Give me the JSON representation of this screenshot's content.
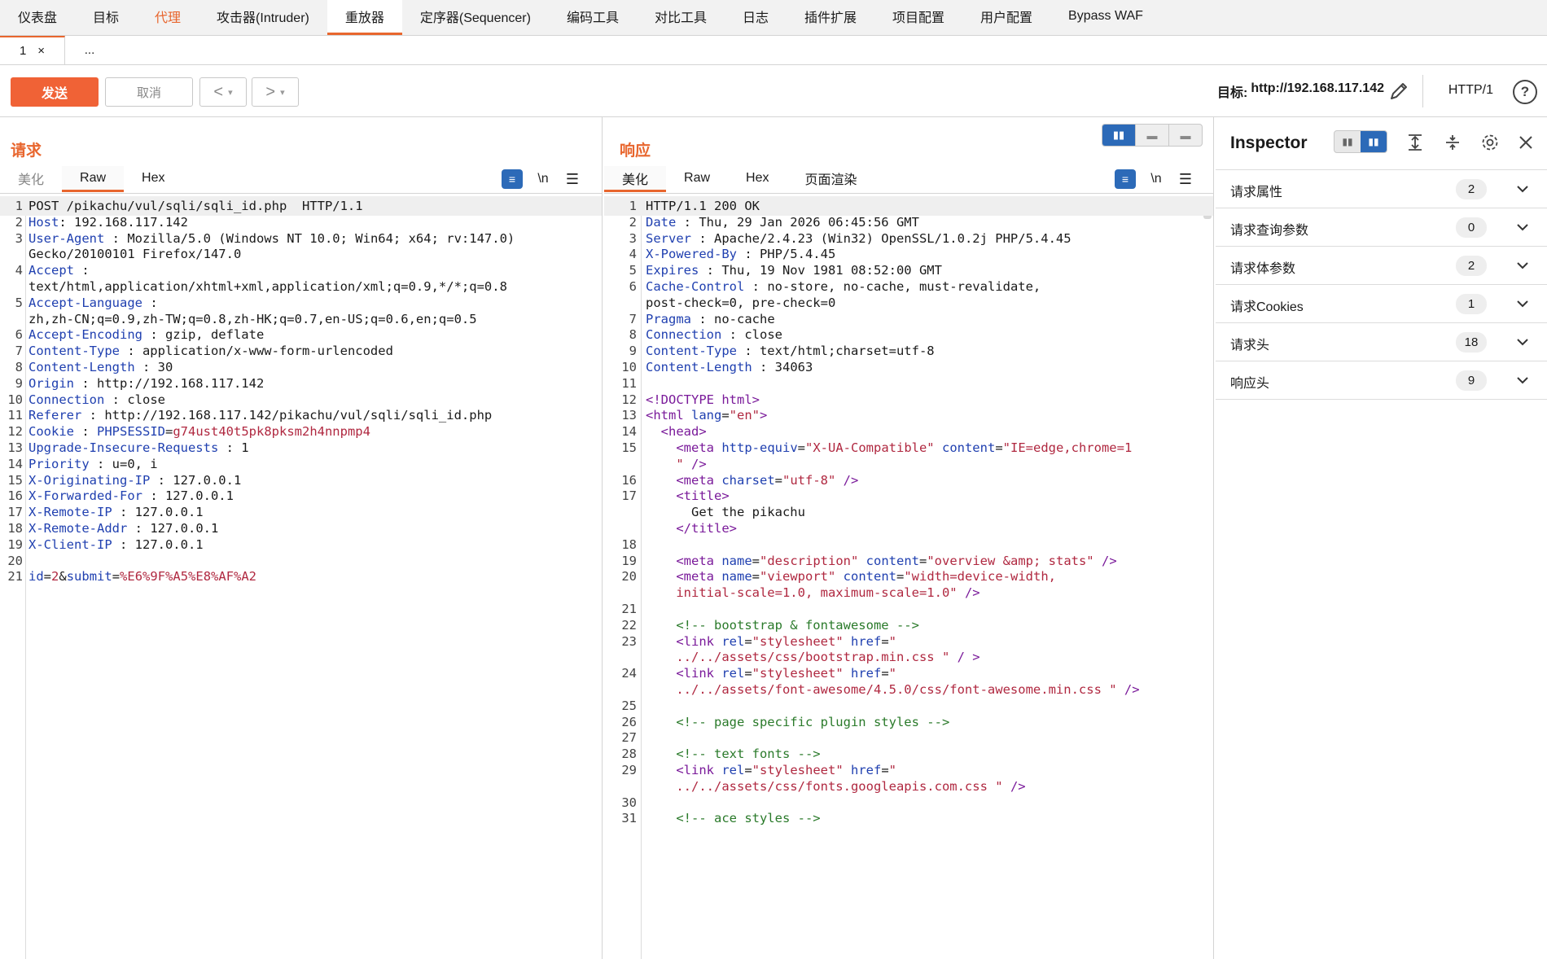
{
  "top_tabs": [
    "仪表盘",
    "目标",
    "代理",
    "攻击器(Intruder)",
    "重放器",
    "定序器(Sequencer)",
    "编码工具",
    "对比工具",
    "日志",
    "插件扩展",
    "项目配置",
    "用户配置",
    "Bypass WAF"
  ],
  "sub_tabs": {
    "first_label": "1",
    "close": "×",
    "more": "..."
  },
  "toolbar": {
    "send": "发送",
    "cancel": "取消",
    "prev": "<",
    "next": ">",
    "dropdown": "▾",
    "target_label": "目标:",
    "target_url": "http://192.168.117.142",
    "http_version": "HTTP/1",
    "help": "?"
  },
  "request": {
    "title": "请求",
    "tabs": [
      "美化",
      "Raw",
      "Hex"
    ],
    "wrap_icon": "≡",
    "newline": "\\n",
    "menu": "☰",
    "lines": [
      {
        "n": "1",
        "parts": [
          [
            "v",
            "POST /pikachu/vul/sqli/sqli_id.php  HTTP/1.1"
          ]
        ]
      },
      {
        "n": "2",
        "parts": [
          [
            "k",
            "Host"
          ],
          [
            "v",
            ": 192.168.117.142"
          ]
        ]
      },
      {
        "n": "3",
        "parts": [
          [
            "k",
            "User-Agent"
          ],
          [
            "v",
            " : Mozilla/5.0 (Windows NT 10.0; Win64; x64; rv:147.0)"
          ]
        ]
      },
      {
        "n": "",
        "parts": [
          [
            "v",
            "Gecko/20100101 Firefox/147.0"
          ]
        ]
      },
      {
        "n": "4",
        "parts": [
          [
            "k",
            "Accept"
          ],
          [
            "v",
            " :"
          ]
        ]
      },
      {
        "n": "",
        "parts": [
          [
            "v",
            "text/html,application/xhtml+xml,application/xml;q=0.9,*/*;q=0.8"
          ]
        ]
      },
      {
        "n": "5",
        "parts": [
          [
            "k",
            "Accept-Language"
          ],
          [
            "v",
            " :"
          ]
        ]
      },
      {
        "n": "",
        "parts": [
          [
            "v",
            "zh,zh-CN;q=0.9,zh-TW;q=0.8,zh-HK;q=0.7,en-US;q=0.6,en;q=0.5"
          ]
        ]
      },
      {
        "n": "6",
        "parts": [
          [
            "k",
            "Accept-Encoding"
          ],
          [
            "v",
            " : gzip, deflate"
          ]
        ]
      },
      {
        "n": "7",
        "parts": [
          [
            "k",
            "Content-Type"
          ],
          [
            "v",
            " : application/x-www-form-urlencoded"
          ]
        ]
      },
      {
        "n": "8",
        "parts": [
          [
            "k",
            "Content-Length"
          ],
          [
            "v",
            " : 30"
          ]
        ]
      },
      {
        "n": "9",
        "parts": [
          [
            "k",
            "Origin"
          ],
          [
            "v",
            " : http://192.168.117.142"
          ]
        ]
      },
      {
        "n": "10",
        "parts": [
          [
            "k",
            "Connection"
          ],
          [
            "v",
            " : close"
          ]
        ]
      },
      {
        "n": "11",
        "parts": [
          [
            "k",
            "Referer"
          ],
          [
            "v",
            " : http://192.168.117.142/pikachu/vul/sqli/sqli_id.php"
          ]
        ]
      },
      {
        "n": "12",
        "parts": [
          [
            "k",
            "Cookie"
          ],
          [
            "v",
            " : "
          ],
          [
            "k",
            "PHPSESSID"
          ],
          [
            "v",
            "="
          ],
          [
            "r",
            "g74ust40t5pk8pksm2h4nnpmp4"
          ]
        ]
      },
      {
        "n": "13",
        "parts": [
          [
            "k",
            "Upgrade-Insecure-Requests"
          ],
          [
            "v",
            " : 1"
          ]
        ]
      },
      {
        "n": "14",
        "parts": [
          [
            "k",
            "Priority"
          ],
          [
            "v",
            " : u=0, i"
          ]
        ]
      },
      {
        "n": "15",
        "parts": [
          [
            "k",
            "X-Originating-IP"
          ],
          [
            "v",
            " : 127.0.0.1"
          ]
        ]
      },
      {
        "n": "16",
        "parts": [
          [
            "k",
            "X-Forwarded-For"
          ],
          [
            "v",
            " : 127.0.0.1"
          ]
        ]
      },
      {
        "n": "17",
        "parts": [
          [
            "k",
            "X-Remote-IP"
          ],
          [
            "v",
            " : 127.0.0.1"
          ]
        ]
      },
      {
        "n": "18",
        "parts": [
          [
            "k",
            "X-Remote-Addr"
          ],
          [
            "v",
            " : 127.0.0.1"
          ]
        ]
      },
      {
        "n": "19",
        "parts": [
          [
            "k",
            "X-Client-IP"
          ],
          [
            "v",
            " : 127.0.0.1"
          ]
        ]
      },
      {
        "n": "20",
        "parts": []
      },
      {
        "n": "21",
        "parts": [
          [
            "k",
            "id"
          ],
          [
            "v",
            "="
          ],
          [
            "r",
            "2"
          ],
          [
            "v",
            "&"
          ],
          [
            "k",
            "submit"
          ],
          [
            "v",
            "="
          ],
          [
            "r",
            "%E6%9F%A5%E8%AF%A2"
          ]
        ]
      }
    ]
  },
  "response": {
    "title": "响应",
    "tabs": [
      "美化",
      "Raw",
      "Hex",
      "页面渲染"
    ],
    "wrap_icon": "≡",
    "newline": "\\n",
    "menu": "☰",
    "layout_icons": [
      "▮▮",
      "▬",
      "▬"
    ],
    "lines": [
      {
        "n": "1",
        "parts": [
          [
            "v",
            "HTTP/1.1 200 OK"
          ]
        ]
      },
      {
        "n": "2",
        "parts": [
          [
            "k",
            "Date"
          ],
          [
            "v",
            " : Thu, 29 Jan 2026 06:45:56 GMT"
          ]
        ]
      },
      {
        "n": "3",
        "parts": [
          [
            "k",
            "Server"
          ],
          [
            "v",
            " : Apache/2.4.23 (Win32) OpenSSL/1.0.2j PHP/5.4.45"
          ]
        ]
      },
      {
        "n": "4",
        "parts": [
          [
            "k",
            "X-Powered-By"
          ],
          [
            "v",
            " : PHP/5.4.45"
          ]
        ]
      },
      {
        "n": "5",
        "parts": [
          [
            "k",
            "Expires"
          ],
          [
            "v",
            " : Thu, 19 Nov 1981 08:52:00 GMT"
          ]
        ]
      },
      {
        "n": "6",
        "parts": [
          [
            "k",
            "Cache-Control"
          ],
          [
            "v",
            " : no-store, no-cache, must-revalidate,"
          ]
        ]
      },
      {
        "n": "",
        "parts": [
          [
            "v",
            "post-check=0, pre-check=0"
          ]
        ]
      },
      {
        "n": "7",
        "parts": [
          [
            "k",
            "Pragma"
          ],
          [
            "v",
            " : no-cache"
          ]
        ]
      },
      {
        "n": "8",
        "parts": [
          [
            "k",
            "Connection"
          ],
          [
            "v",
            " : close"
          ]
        ]
      },
      {
        "n": "9",
        "parts": [
          [
            "k",
            "Content-Type"
          ],
          [
            "v",
            " : text/html;charset=utf-8"
          ]
        ]
      },
      {
        "n": "10",
        "parts": [
          [
            "k",
            "Content-Length"
          ],
          [
            "v",
            " : 34063"
          ]
        ]
      },
      {
        "n": "11",
        "parts": []
      },
      {
        "n": "12",
        "parts": [
          [
            "t",
            "<!DOCTYPE html>"
          ]
        ]
      },
      {
        "n": "13",
        "parts": [
          [
            "t",
            "<html "
          ],
          [
            "a",
            "lang"
          ],
          [
            "v",
            "="
          ],
          [
            "s",
            "\"en\""
          ],
          [
            "t",
            ">"
          ]
        ]
      },
      {
        "n": "14",
        "parts": [
          [
            "t",
            "  <head>"
          ]
        ]
      },
      {
        "n": "15",
        "parts": [
          [
            "t",
            "    <meta "
          ],
          [
            "a",
            "http-equiv"
          ],
          [
            "v",
            "="
          ],
          [
            "s",
            "\"X-UA-Compatible\""
          ],
          [
            "v",
            " "
          ],
          [
            "a",
            "content"
          ],
          [
            "v",
            "="
          ],
          [
            "s",
            "\"IE=edge,chrome=1"
          ]
        ]
      },
      {
        "n": "",
        "parts": [
          [
            "s",
            "    \""
          ],
          [
            "t",
            " />"
          ]
        ]
      },
      {
        "n": "16",
        "parts": [
          [
            "t",
            "    <meta "
          ],
          [
            "a",
            "charset"
          ],
          [
            "v",
            "="
          ],
          [
            "s",
            "\"utf-8\""
          ],
          [
            "t",
            " />"
          ]
        ]
      },
      {
        "n": "17",
        "parts": [
          [
            "t",
            "    <title>"
          ]
        ]
      },
      {
        "n": "",
        "parts": [
          [
            "v",
            "      Get the pikachu"
          ]
        ]
      },
      {
        "n": "",
        "parts": [
          [
            "t",
            "    </title>"
          ]
        ]
      },
      {
        "n": "18",
        "parts": []
      },
      {
        "n": "19",
        "parts": [
          [
            "t",
            "    <meta "
          ],
          [
            "a",
            "name"
          ],
          [
            "v",
            "="
          ],
          [
            "s",
            "\"description\""
          ],
          [
            "v",
            " "
          ],
          [
            "a",
            "content"
          ],
          [
            "v",
            "="
          ],
          [
            "s",
            "\"overview &amp; stats\""
          ],
          [
            "t",
            " />"
          ]
        ]
      },
      {
        "n": "20",
        "parts": [
          [
            "t",
            "    <meta "
          ],
          [
            "a",
            "name"
          ],
          [
            "v",
            "="
          ],
          [
            "s",
            "\"viewport\""
          ],
          [
            "v",
            " "
          ],
          [
            "a",
            "content"
          ],
          [
            "v",
            "="
          ],
          [
            "s",
            "\"width=device-width,"
          ]
        ]
      },
      {
        "n": "",
        "parts": [
          [
            "s",
            "    initial-scale=1.0, maximum-scale=1.0\""
          ],
          [
            "t",
            " />"
          ]
        ]
      },
      {
        "n": "21",
        "parts": []
      },
      {
        "n": "22",
        "parts": [
          [
            "c",
            "    <!-- bootstrap & fontawesome -->"
          ]
        ]
      },
      {
        "n": "23",
        "parts": [
          [
            "t",
            "    <link "
          ],
          [
            "a",
            "rel"
          ],
          [
            "v",
            "="
          ],
          [
            "s",
            "\"stylesheet\""
          ],
          [
            "v",
            " "
          ],
          [
            "a",
            "href"
          ],
          [
            "v",
            "="
          ],
          [
            "s",
            "\""
          ]
        ]
      },
      {
        "n": "",
        "parts": [
          [
            "s",
            "    ../../assets/css/bootstrap.min.css \""
          ],
          [
            "t",
            " / >"
          ]
        ]
      },
      {
        "n": "24",
        "parts": [
          [
            "t",
            "    <link "
          ],
          [
            "a",
            "rel"
          ],
          [
            "v",
            "="
          ],
          [
            "s",
            "\"stylesheet\""
          ],
          [
            "v",
            " "
          ],
          [
            "a",
            "href"
          ],
          [
            "v",
            "="
          ],
          [
            "s",
            "\""
          ]
        ]
      },
      {
        "n": "",
        "parts": [
          [
            "s",
            "    ../../assets/font-awesome/4.5.0/css/font-awesome.min.css \""
          ],
          [
            "t",
            " />"
          ]
        ]
      },
      {
        "n": "25",
        "parts": []
      },
      {
        "n": "26",
        "parts": [
          [
            "c",
            "    <!-- page specific plugin styles -->"
          ]
        ]
      },
      {
        "n": "27",
        "parts": []
      },
      {
        "n": "28",
        "parts": [
          [
            "c",
            "    <!-- text fonts -->"
          ]
        ]
      },
      {
        "n": "29",
        "parts": [
          [
            "t",
            "    <link "
          ],
          [
            "a",
            "rel"
          ],
          [
            "v",
            "="
          ],
          [
            "s",
            "\"stylesheet\""
          ],
          [
            "v",
            " "
          ],
          [
            "a",
            "href"
          ],
          [
            "v",
            "="
          ],
          [
            "s",
            "\""
          ]
        ]
      },
      {
        "n": "",
        "parts": [
          [
            "s",
            "    ../../assets/css/fonts.googleapis.com.css \""
          ],
          [
            "t",
            " />"
          ]
        ]
      },
      {
        "n": "30",
        "parts": []
      },
      {
        "n": "31",
        "parts": [
          [
            "c",
            "    <!-- ace styles -->"
          ]
        ]
      }
    ]
  },
  "inspector": {
    "title": "Inspector",
    "sections": [
      {
        "label": "请求属性",
        "count": "2"
      },
      {
        "label": "请求查询参数",
        "count": "0"
      },
      {
        "label": "请求体参数",
        "count": "2"
      },
      {
        "label": "请求Cookies",
        "count": "1"
      },
      {
        "label": "请求头",
        "count": "18"
      },
      {
        "label": "响应头",
        "count": "9"
      }
    ]
  },
  "colors": {
    "accent": "#e8662e",
    "blue": "#2c6ab8",
    "key": "#2040b0",
    "value_red": "#b02840",
    "comment": "#2a7a2a",
    "tag": "#7a1a9a"
  }
}
